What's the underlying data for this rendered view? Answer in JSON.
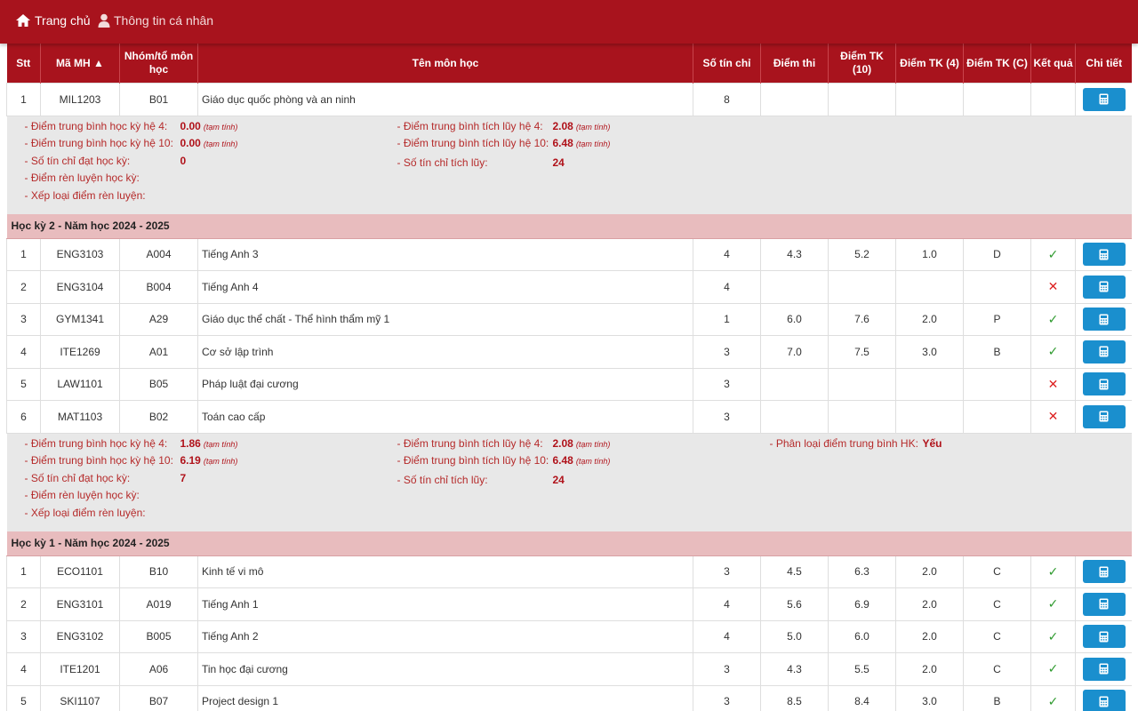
{
  "nav": {
    "home": "Trang chủ",
    "profile": "Thông tin cá nhân"
  },
  "table": {
    "headers": {
      "stt": "Stt",
      "ma_mh": "Mã MH ▲",
      "nhom": "Nhóm/tổ môn học",
      "ten": "Tên môn học",
      "so_tc": "Số tín chỉ",
      "diem_thi": "Điểm thi",
      "tk10": "Điểm TK (10)",
      "tk4": "Điểm TK (4)",
      "tkc": "Điểm TK (C)",
      "ket_qua": "Kết quả",
      "chi_tiet": "Chi tiết"
    }
  },
  "block0": {
    "rows": [
      {
        "stt": "1",
        "ma": "MIL1203",
        "nhom": "B01",
        "ten": "Giáo dục quốc phòng và an ninh",
        "tc": "8",
        "thi": "",
        "tk10": "",
        "tk4": "",
        "tkc": "",
        "kq": ""
      }
    ],
    "summary": {
      "l1": "- Điểm trung bình học kỳ hệ 4:",
      "v1": "0.00",
      "n1": "(tạm tính)",
      "l2": "- Điểm trung bình học kỳ hệ 10:",
      "v2": "0.00",
      "n2": "(tạm tính)",
      "l3": "- Số tín chỉ đạt học kỳ:",
      "v3": "0",
      "l4": "- Điểm rèn luyện học kỳ:",
      "l5": "- Xếp loại điểm rèn luyện:",
      "m1": "- Điểm trung bình tích lũy hệ 4:",
      "mv1": "2.08",
      "mn1": "(tạm tính)",
      "m2": "- Điểm trung bình tích lũy hệ 10:",
      "mv2": "6.48",
      "mn2": "(tạm tính)",
      "m3": "- Số tín chỉ tích lũy:",
      "mv3": "24"
    }
  },
  "sem2": {
    "title": "Học kỳ 2 - Năm học 2024 - 2025",
    "rows": [
      {
        "stt": "1",
        "ma": "ENG3103",
        "nhom": "A004",
        "ten": "Tiếng Anh 3",
        "tc": "4",
        "thi": "4.3",
        "tk10": "5.2",
        "tk4": "1.0",
        "tkc": "D",
        "kq": "✓"
      },
      {
        "stt": "2",
        "ma": "ENG3104",
        "nhom": "B004",
        "ten": "Tiếng Anh 4",
        "tc": "4",
        "thi": "",
        "tk10": "",
        "tk4": "",
        "tkc": "",
        "kq": "✕"
      },
      {
        "stt": "3",
        "ma": "GYM1341",
        "nhom": "A29",
        "ten": "Giáo dục thể chất - Thể hình thẩm mỹ 1",
        "tc": "1",
        "thi": "6.0",
        "tk10": "7.6",
        "tk4": "2.0",
        "tkc": "P",
        "kq": "✓"
      },
      {
        "stt": "4",
        "ma": "ITE1269",
        "nhom": "A01",
        "ten": "Cơ sở lập trình",
        "tc": "3",
        "thi": "7.0",
        "tk10": "7.5",
        "tk4": "3.0",
        "tkc": "B",
        "kq": "✓"
      },
      {
        "stt": "5",
        "ma": "LAW1101",
        "nhom": "B05",
        "ten": "Pháp luật đại cương",
        "tc": "3",
        "thi": "",
        "tk10": "",
        "tk4": "",
        "tkc": "",
        "kq": "✕"
      },
      {
        "stt": "6",
        "ma": "MAT1103",
        "nhom": "B02",
        "ten": "Toán cao cấp",
        "tc": "3",
        "thi": "",
        "tk10": "",
        "tk4": "",
        "tkc": "",
        "kq": "✕"
      }
    ],
    "summary": {
      "l1": "- Điểm trung bình học kỳ hệ 4:",
      "v1": "1.86",
      "n1": "(tạm tính)",
      "l2": "- Điểm trung bình học kỳ hệ 10:",
      "v2": "6.19",
      "n2": "(tạm tính)",
      "l3": "- Số tín chỉ đạt học kỳ:",
      "v3": "7",
      "l4": "- Điểm rèn luyện học kỳ:",
      "l5": "- Xếp loại điểm rèn luyện:",
      "m1": "- Điểm trung bình tích lũy hệ 4:",
      "mv1": "2.08",
      "mn1": "(tạm tính)",
      "m2": "- Điểm trung bình tích lũy hệ 10:",
      "mv2": "6.48",
      "mn2": "(tạm tính)",
      "m3": "- Số tín chỉ tích lũy:",
      "mv3": "24",
      "r1": "- Phân loại điểm trung bình HK:",
      "rv1": "Yếu"
    }
  },
  "sem1": {
    "title": "Học kỳ 1 - Năm học 2024 - 2025",
    "rows": [
      {
        "stt": "1",
        "ma": "ECO1101",
        "nhom": "B10",
        "ten": "Kinh tế vi mô",
        "tc": "3",
        "thi": "4.5",
        "tk10": "6.3",
        "tk4": "2.0",
        "tkc": "C",
        "kq": "✓"
      },
      {
        "stt": "2",
        "ma": "ENG3101",
        "nhom": "A019",
        "ten": "Tiếng Anh 1",
        "tc": "4",
        "thi": "5.6",
        "tk10": "6.9",
        "tk4": "2.0",
        "tkc": "C",
        "kq": "✓"
      },
      {
        "stt": "3",
        "ma": "ENG3102",
        "nhom": "B005",
        "ten": "Tiếng Anh 2",
        "tc": "4",
        "thi": "5.0",
        "tk10": "6.0",
        "tk4": "2.0",
        "tkc": "C",
        "kq": "✓"
      },
      {
        "stt": "4",
        "ma": "ITE1201",
        "nhom": "A06",
        "ten": "Tin học đại cương",
        "tc": "3",
        "thi": "4.3",
        "tk10": "5.5",
        "tk4": "2.0",
        "tkc": "C",
        "kq": "✓"
      },
      {
        "stt": "5",
        "ma": "SKI1107",
        "nhom": "B07",
        "ten": "Project design 1",
        "tc": "3",
        "thi": "8.5",
        "tk10": "8.4",
        "tk4": "3.0",
        "tkc": "B",
        "kq": "✓"
      }
    ]
  },
  "icons": {
    "home": "home-icon",
    "user": "user-icon",
    "detail": "calculator-icon"
  },
  "colors": {
    "brand": "#a8131d",
    "semester_bg": "#e8bcbe",
    "summary_bg": "#e8e8e8",
    "button": "#1a8fce",
    "ok": "#2e9a2e",
    "fail": "#d22222"
  }
}
